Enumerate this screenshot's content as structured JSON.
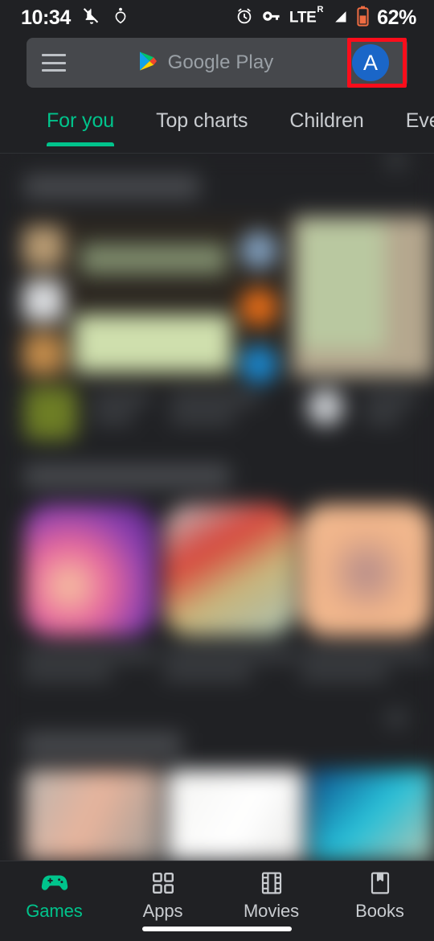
{
  "status_bar": {
    "time": "10:34",
    "icons_left": [
      "notifications-off-icon",
      "person-heart-icon"
    ],
    "icons_right": [
      "alarm-icon",
      "vpn-key-icon",
      "signal-icon",
      "battery-icon"
    ],
    "network": "LTE",
    "network_sup": "R",
    "battery": "62%"
  },
  "search": {
    "menu_icon": "hamburger-menu-icon",
    "logo_icon": "google-play-logo",
    "placeholder": "Google Play",
    "avatar_letter": "A",
    "avatar_color": "#1a66c8",
    "highlight_color": "#fb0d1b"
  },
  "tabs": [
    {
      "label": "For you",
      "active": true
    },
    {
      "label": "Top charts",
      "active": false
    },
    {
      "label": "Children",
      "active": false
    },
    {
      "label": "Even",
      "active": false
    }
  ],
  "bottom_nav": [
    {
      "label": "Games",
      "icon": "gamepad-icon",
      "active": true
    },
    {
      "label": "Apps",
      "icon": "apps-grid-icon",
      "active": false
    },
    {
      "label": "Movies",
      "icon": "film-strip-icon",
      "active": false
    },
    {
      "label": "Books",
      "icon": "book-bookmark-icon",
      "active": false
    }
  ],
  "theme": {
    "background": "#202124",
    "accent": "#00c48c",
    "search_bg": "#46484c",
    "text_primary": "#c9ccd0",
    "text_muted": "#9aa0a6"
  }
}
